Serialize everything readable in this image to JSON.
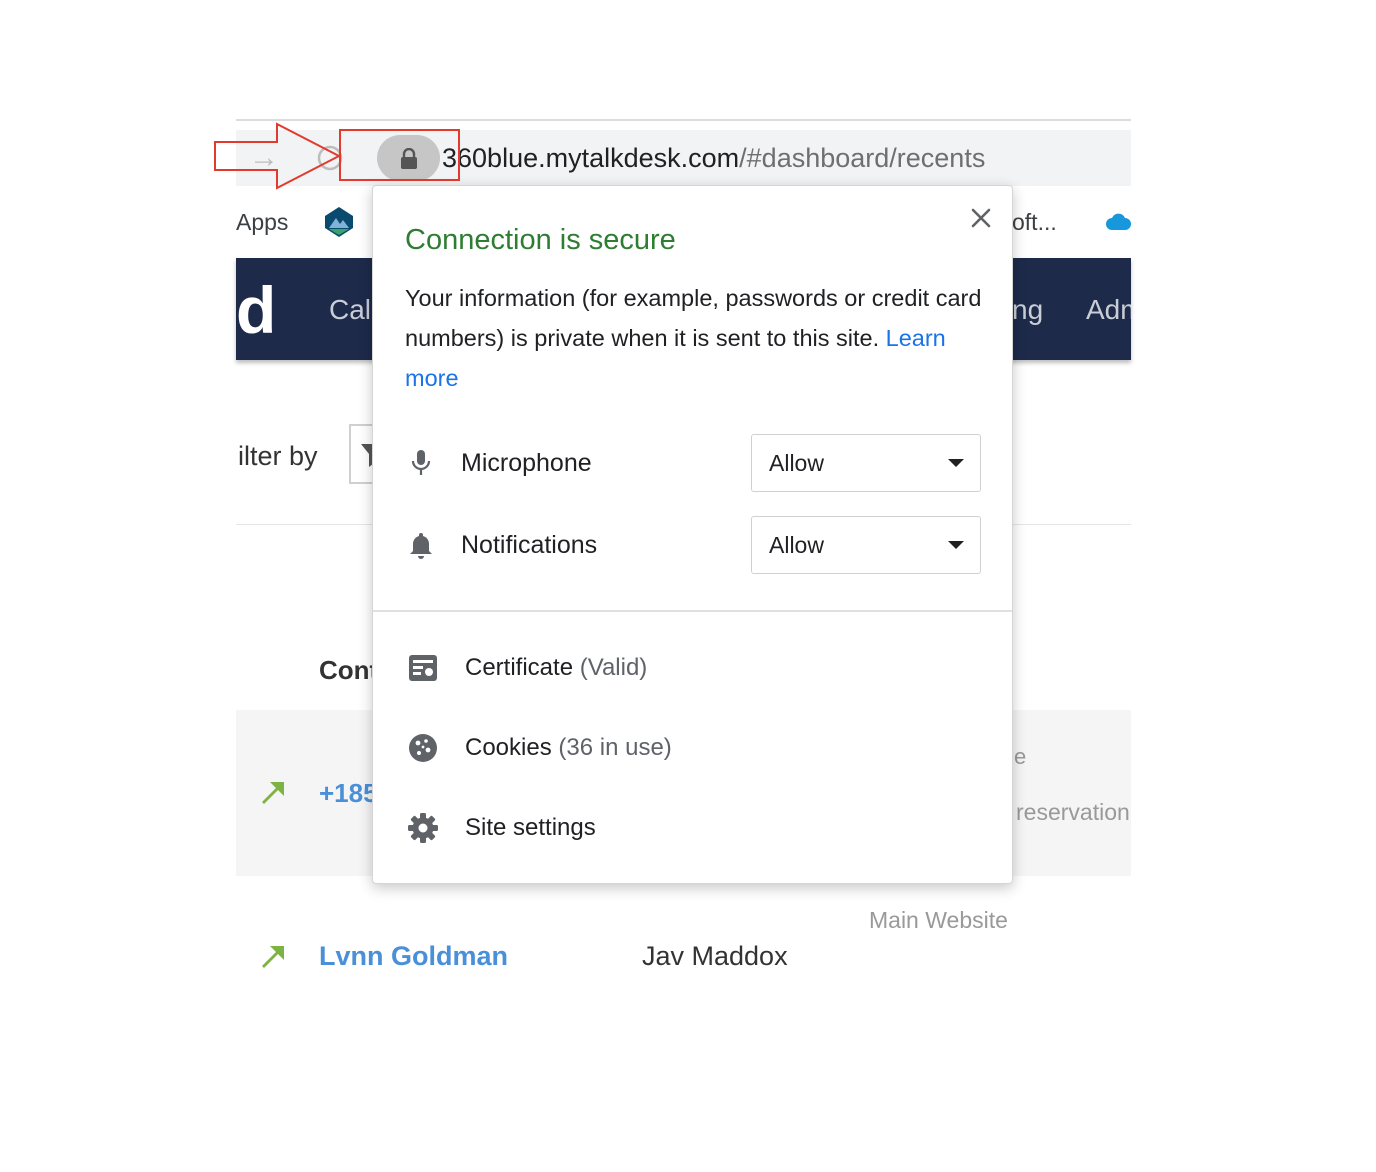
{
  "browser": {
    "url_host": "360blue.mytalkdesk.com",
    "url_path": "/#dashboard/recents",
    "annotation_color": "#e23b2e"
  },
  "bookmarks": {
    "apps_label": "Apps",
    "partial_label": "…",
    "oft_label": "oft..."
  },
  "app_nav": {
    "logo_fragment": "d",
    "call_fragment": "Cal",
    "ng_fragment": "ng",
    "admin_fragment": "Adm",
    "bg_color": "#1d2a4a"
  },
  "filter": {
    "label": "ilter by"
  },
  "table": {
    "header_fragment": "Cont",
    "row1": {
      "phone_fragment": "+185",
      "right_fragment_1": "e",
      "right_fragment_2": "reservation"
    },
    "row2": {
      "source": "Main Website",
      "contact": "Lvnn Goldman",
      "agent": "Jav Maddox"
    }
  },
  "popup": {
    "title": "Connection is secure",
    "title_color": "#2e7d32",
    "description": "Your information (for example, passwords or credit card numbers) is private when it is sent to this site.",
    "learn_more": "Learn more",
    "permissions": [
      {
        "icon": "microphone-icon",
        "label": "Microphone",
        "value": "Allow"
      },
      {
        "icon": "bell-icon",
        "label": "Notifications",
        "value": "Allow"
      }
    ],
    "menu": [
      {
        "icon": "certificate-icon",
        "label": "Certificate",
        "sub": "(Valid)"
      },
      {
        "icon": "cookie-icon",
        "label": "Cookies",
        "sub": "(36 in use)"
      },
      {
        "icon": "gear-icon",
        "label": "Site settings",
        "sub": ""
      }
    ]
  }
}
